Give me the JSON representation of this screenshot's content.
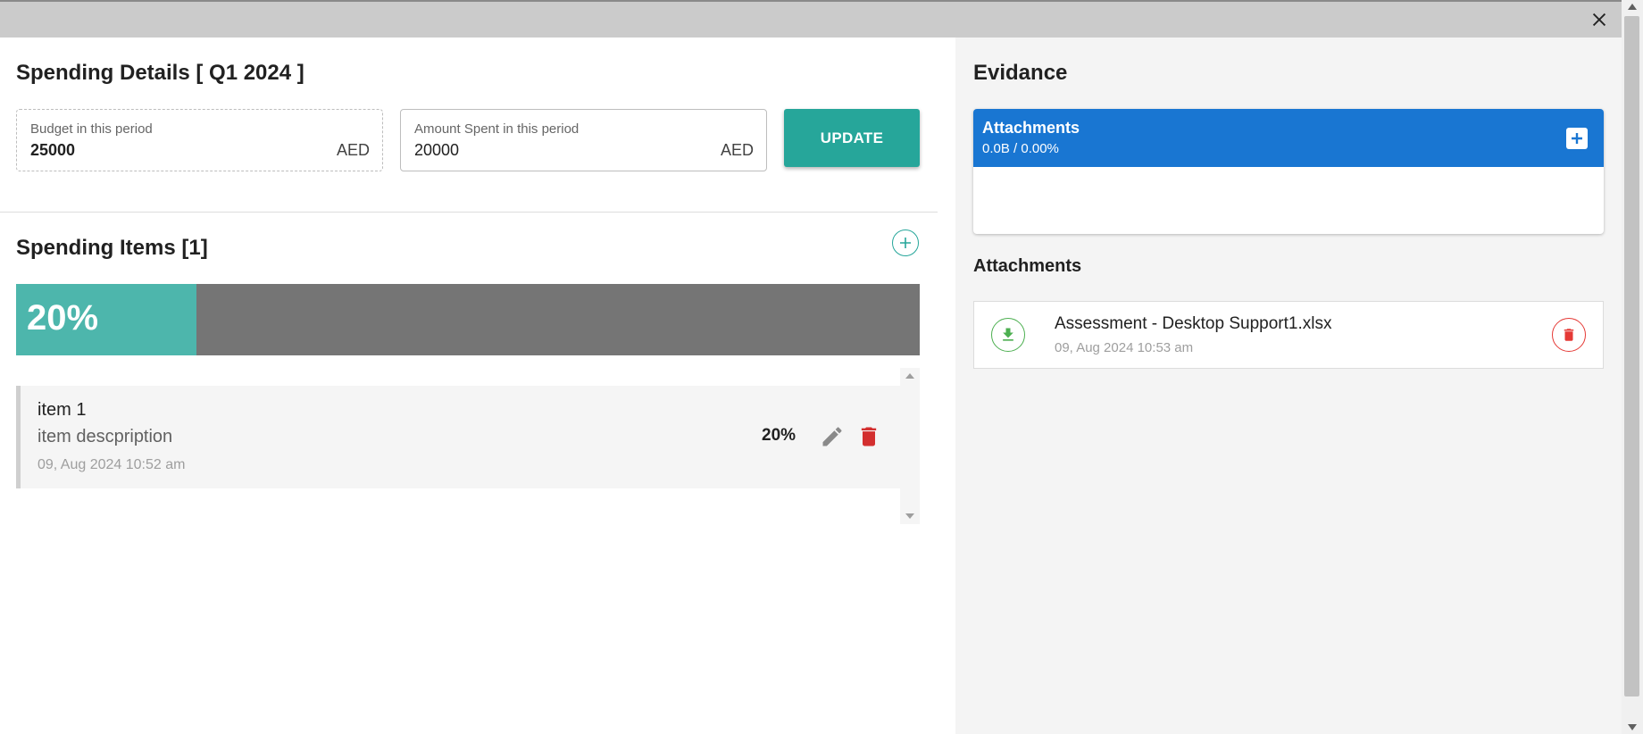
{
  "dialog": {
    "close_icon": "close-icon"
  },
  "spending_details": {
    "title": "Spending Details [ Q1 2024 ]",
    "budget": {
      "label": "Budget in this period",
      "value": "25000",
      "currency": "AED"
    },
    "amount_spent": {
      "label": "Amount Spent in this period",
      "value": "20000",
      "currency": "AED"
    },
    "update_label": "UPDATE"
  },
  "spending_items": {
    "title": "Spending Items [1]",
    "progress_text": "20%",
    "progress_fraction": 0.2,
    "items": [
      {
        "title": "item 1",
        "description": "item descpription",
        "date": "09, Aug 2024 10:52 am",
        "percent": "20%"
      }
    ]
  },
  "evidence": {
    "title": "Evidance",
    "card": {
      "title": "Attachments",
      "usage": "0.0B / 0.00%"
    },
    "list_title": "Attachments",
    "files": [
      {
        "name": "Assessment - Desktop Support1.xlsx",
        "date": "09, Aug 2024 10:53 am"
      }
    ]
  },
  "colors": {
    "accent_teal": "#26a69a",
    "progress_fill": "#4db6ac",
    "progress_track": "#757575",
    "attachments_header": "#1976d2",
    "delete_red": "#e53935",
    "download_green": "#4caf50"
  }
}
